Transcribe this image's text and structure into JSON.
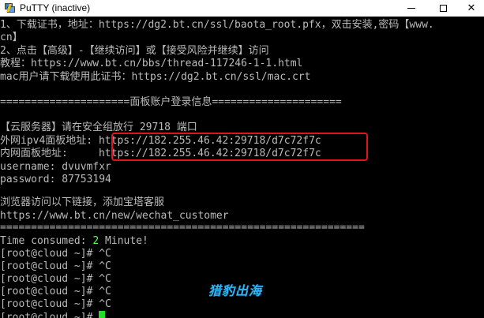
{
  "window": {
    "title": "PuTTY (inactive)",
    "minimize_label": "",
    "maximize_label": "",
    "close_label": "✕"
  },
  "terminal": {
    "lines": [
      "1、下载证书，地址：https://dg2.bt.cn/ssl/baota_root.pfx，双击安装,密码【www.",
      "cn】",
      "2、点击【高级】-【继续访问】或【接受风险并继续】访问",
      "教程：https://www.bt.cn/bbs/thread-117246-1-1.html",
      "mac用户请下载使用此证书：https://dg2.bt.cn/ssl/mac.crt",
      "",
      "=====================面板账户登录信息=====================",
      "",
      "【云服务器】请在安全组放行 29718 端口",
      "外网ipv4面板地址: https://182.255.46.42:29718/d7c72f7c",
      "内网面板地址:     https://182.255.46.42:29718/d7c72f7c",
      "username: dvuvmfxr",
      "password: 87753194",
      "",
      "浏览器访问以下链接，添加宝塔客服",
      "https://www.bt.cn/new/wechat_customer",
      "===========================================================",
      "",
      "Time consumed: ",
      "[root@cloud ~]# ^C",
      "[root@cloud ~]# ^C",
      "[root@cloud ~]# ^C",
      "[root@cloud ~]# ^C",
      "[root@cloud ~]# ^C",
      "[root@cloud ~]# "
    ],
    "time_value": "2",
    "time_unit": " Minute!"
  },
  "watermark": "猎豹出海",
  "colors": {
    "background": "#000000",
    "text": "#bbbbbb",
    "green": "#55ff55",
    "highlight_border": "#e0141e",
    "watermark": "#2fb3f3"
  }
}
